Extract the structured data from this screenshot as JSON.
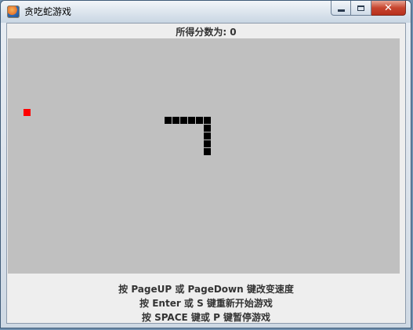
{
  "window": {
    "title": "贪吃蛇游戏",
    "buttons": {
      "minimize": "minimize-icon",
      "maximize": "maximize-icon",
      "close": "✕"
    }
  },
  "score": {
    "label": "所得分数为: 0",
    "value": 0
  },
  "board": {
    "background": "#c0c0c0",
    "grid_size": 10,
    "food_color": "#ff0000",
    "snake_color": "#000000",
    "food": {
      "col": 2,
      "row": 9
    },
    "snake": [
      {
        "col": 25,
        "row": 10
      },
      {
        "col": 25,
        "row": 11
      },
      {
        "col": 25,
        "row": 12
      },
      {
        "col": 25,
        "row": 13
      },
      {
        "col": 25,
        "row": 14
      },
      {
        "col": 24,
        "row": 10
      },
      {
        "col": 23,
        "row": 10
      },
      {
        "col": 22,
        "row": 10
      },
      {
        "col": 21,
        "row": 10
      },
      {
        "col": 20,
        "row": 10
      }
    ]
  },
  "instructions": [
    "按 PageUP 或 PageDown 键改变速度",
    "按 Enter 或 S 键重新开始游戏",
    "按 SPACE 键或 P 键暂停游戏"
  ]
}
